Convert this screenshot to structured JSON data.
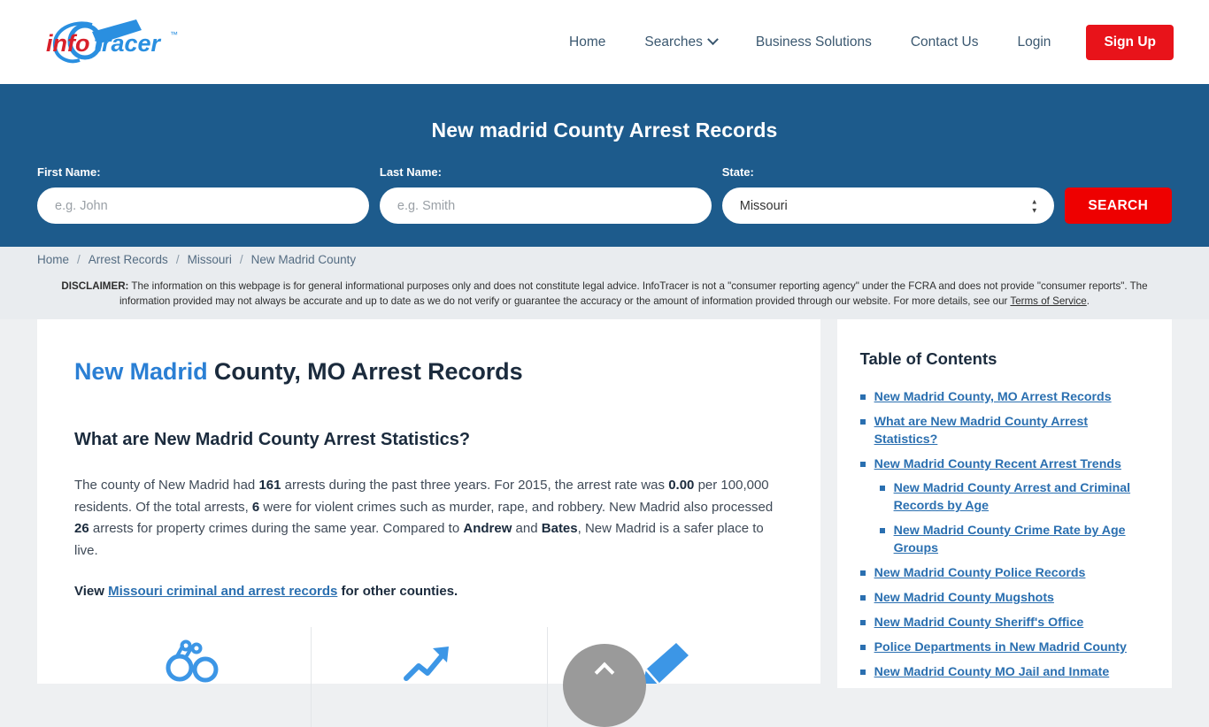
{
  "header": {
    "logo_text": "infotracer",
    "logo_tm": "™",
    "nav": [
      {
        "label": "Home",
        "has_caret": false
      },
      {
        "label": "Searches",
        "has_caret": true
      },
      {
        "label": "Business Solutions",
        "has_caret": false
      },
      {
        "label": "Contact Us",
        "has_caret": false
      },
      {
        "label": "Login",
        "has_caret": false
      }
    ],
    "signup_label": "Sign Up"
  },
  "banner": {
    "title": "New madrid County Arrest Records",
    "first_name_label": "First Name:",
    "first_name_placeholder": "e.g. John",
    "first_name_value": "",
    "last_name_label": "Last Name:",
    "last_name_placeholder": "e.g. Smith",
    "last_name_value": "",
    "state_label": "State:",
    "state_value": "Missouri",
    "state_options": [
      "Missouri"
    ],
    "search_label": "SEARCH",
    "bg_color": "#1d5b8c",
    "accent_red": "#ee0000"
  },
  "breadcrumb": {
    "items": [
      "Home",
      "Arrest Records",
      "Missouri",
      "New Madrid County"
    ],
    "separator": "/"
  },
  "disclaimer": {
    "label": "DISCLAIMER:",
    "text_part1": " The information on this webpage is for general informational purposes only and does not constitute legal advice. InfoTracer is not a \"consumer reporting agency\" under the FCRA and does not provide \"consumer reports\". The information provided may not always be accurate and up to date as we do not verify or guarantee the accuracy or the amount of information provided through our website. For more details, see our ",
    "link_text": "Terms of Service",
    "text_part2": "."
  },
  "main": {
    "title_highlight": "New Madrid",
    "title_rest": " County, MO Arrest Records",
    "subtitle": "What are New Madrid County Arrest Statistics?",
    "paragraph": {
      "s1": "The county of New Madrid had ",
      "b1": "161",
      "s2": " arrests during the past three years. For 2015, the arrest rate was ",
      "b2": "0.00",
      "s3": " per 100,000 residents. Of the total arrests, ",
      "b3": "6",
      "s4": " were for violent crimes such as murder, rape, and robbery. New Madrid also processed ",
      "b4": "26",
      "s5": " arrests for property crimes during the same year. Compared to ",
      "b5": "Andrew",
      "s6": " and ",
      "b6": "Bates",
      "s7": ", New Madrid is a safer place to live."
    },
    "view_line": {
      "prefix": "View ",
      "link": "Missouri criminal and arrest records",
      "suffix": " for other counties."
    },
    "icons": [
      "handcuffs-icon",
      "trend-arrow-icon",
      "pen-icon"
    ]
  },
  "toc": {
    "title": "Table of Contents",
    "items": [
      {
        "label": "New Madrid County, MO Arrest Records",
        "children": []
      },
      {
        "label": "What are New Madrid County Arrest Statistics?",
        "children": []
      },
      {
        "label": "New Madrid County Recent Arrest Trends",
        "children": [
          {
            "label": "New Madrid County Arrest and Criminal Records by Age"
          },
          {
            "label": "New Madrid County Crime Rate by Age Groups"
          }
        ]
      },
      {
        "label": "New Madrid County Police Records",
        "children": []
      },
      {
        "label": "New Madrid County Mugshots",
        "children": []
      },
      {
        "label": "New Madrid County Sheriff's Office",
        "children": []
      },
      {
        "label": "Police Departments in New Madrid County",
        "children": []
      },
      {
        "label": "New Madrid County MO Jail and Inmate",
        "children": []
      }
    ]
  },
  "scroll_top": {
    "name": "scroll-to-top"
  }
}
